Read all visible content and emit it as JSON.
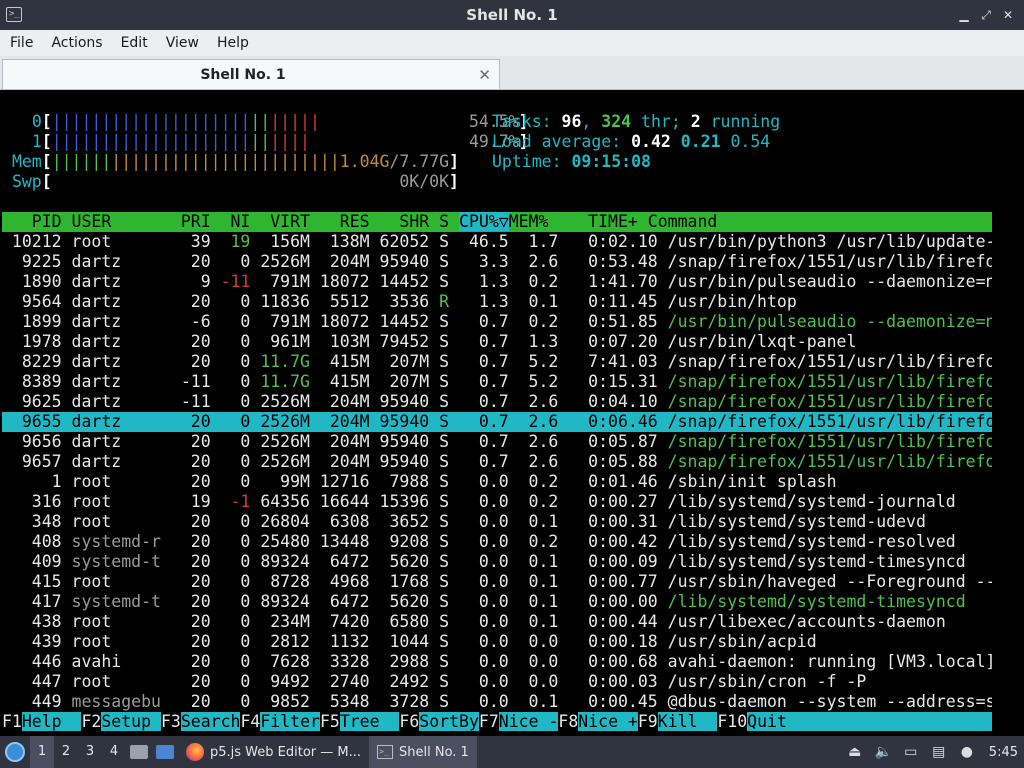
{
  "window": {
    "title": "Shell No. 1",
    "icon": "terminal-icon",
    "controls": [
      "minimize",
      "maximize",
      "close"
    ]
  },
  "menu": [
    "File",
    "Actions",
    "Edit",
    "View",
    "Help"
  ],
  "tab": {
    "label": "Shell No. 1",
    "close_glyph": "✕"
  },
  "htop": {
    "meters": [
      {
        "label": "0",
        "bar_blue": "||||||||||||||||||||",
        "bar_green": "||",
        "bar_red": "|||||",
        "value": "54.5%"
      },
      {
        "label": "1",
        "bar_blue": "||||||||||||||||||||",
        "bar_green": "||",
        "bar_red": "||||",
        "value": "49.7%"
      },
      {
        "label": "Mem",
        "bar_green": "||||||",
        "bar_orange": "|||||||||||||||||||||||",
        "value_prefix": "1.04G",
        "value_suffix": "/7.77G"
      },
      {
        "label": "Swp",
        "value": "0K/0K"
      }
    ],
    "tasks": {
      "label": "Tasks: ",
      "count": "96",
      "sep1": ", ",
      "threads": "324",
      "thr_label": " thr; ",
      "running": "2",
      "running_label": " running"
    },
    "load": {
      "label": "Load average: ",
      "l1": "0.42",
      "l5": "0.21",
      "l15": "0.54"
    },
    "uptime": {
      "label": "Uptime: ",
      "value": "09:15:08"
    },
    "columns": [
      "PID",
      "USER",
      "PRI",
      "NI",
      "VIRT",
      "RES",
      "SHR",
      "S",
      "CPU%▽",
      "MEM%",
      "TIME+",
      "Command"
    ],
    "sort_column": "CPU%▽",
    "selected_pid": "9655",
    "processes": [
      {
        "pid": "10212",
        "user": "root",
        "pri": "39",
        "ni": "19",
        "virt": "156M",
        "res": "138M",
        "shr": "62052",
        "s": "S",
        "cpu": "46.5",
        "mem": "1.7",
        "time": "0:02.10",
        "cmd": "/usr/bin/python3 /usr/lib/update-n"
      },
      {
        "pid": "9225",
        "user": "dartz",
        "pri": "20",
        "ni": "0",
        "virt": "2526M",
        "res": "204M",
        "shr": "95940",
        "s": "S",
        "cpu": "3.3",
        "mem": "2.6",
        "time": "0:53.48",
        "cmd": "/snap/firefox/1551/usr/lib/firefox"
      },
      {
        "pid": "1890",
        "user": "dartz",
        "pri": "9",
        "ni": "-11",
        "virt": "791M",
        "res": "18072",
        "shr": "14452",
        "s": "S",
        "cpu": "1.3",
        "mem": "0.2",
        "time": "1:41.70",
        "cmd": "/usr/bin/pulseaudio --daemonize=no"
      },
      {
        "pid": "9564",
        "user": "dartz",
        "pri": "20",
        "ni": "0",
        "virt": "11836",
        "res": "5512",
        "shr": "3536",
        "s": "R",
        "cpu": "1.3",
        "mem": "0.1",
        "time": "0:11.45",
        "cmd": "/usr/bin/htop"
      },
      {
        "pid": "1899",
        "user": "dartz",
        "pri": "-6",
        "ni": "0",
        "virt": "791M",
        "res": "18072",
        "shr": "14452",
        "s": "S",
        "cpu": "0.7",
        "mem": "0.2",
        "time": "0:51.85",
        "cmd": "/usr/bin/pulseaudio --daemonize=no",
        "thread": true
      },
      {
        "pid": "1978",
        "user": "dartz",
        "pri": "20",
        "ni": "0",
        "virt": "961M",
        "res": "103M",
        "shr": "79452",
        "s": "S",
        "cpu": "0.7",
        "mem": "1.3",
        "time": "0:07.20",
        "cmd": "/usr/bin/lxqt-panel"
      },
      {
        "pid": "8229",
        "user": "dartz",
        "pri": "20",
        "ni": "0",
        "virt": "11.7G",
        "res": "415M",
        "shr": "207M",
        "s": "S",
        "cpu": "0.7",
        "mem": "5.2",
        "time": "7:41.03",
        "cmd": "/snap/firefox/1551/usr/lib/firefox"
      },
      {
        "pid": "8389",
        "user": "dartz",
        "pri": "-11",
        "ni": "0",
        "virt": "11.7G",
        "res": "415M",
        "shr": "207M",
        "s": "S",
        "cpu": "0.7",
        "mem": "5.2",
        "time": "0:15.31",
        "cmd": "/snap/firefox/1551/usr/lib/firefox",
        "thread": true
      },
      {
        "pid": "9625",
        "user": "dartz",
        "pri": "-11",
        "ni": "0",
        "virt": "2526M",
        "res": "204M",
        "shr": "95940",
        "s": "S",
        "cpu": "0.7",
        "mem": "2.6",
        "time": "0:04.10",
        "cmd": "/snap/firefox/1551/usr/lib/firefox",
        "thread": true
      },
      {
        "pid": "9655",
        "user": "dartz",
        "pri": "20",
        "ni": "0",
        "virt": "2526M",
        "res": "204M",
        "shr": "95940",
        "s": "S",
        "cpu": "0.7",
        "mem": "2.6",
        "time": "0:06.46",
        "cmd": "/snap/firefox/1551/usr/lib/firefox"
      },
      {
        "pid": "9656",
        "user": "dartz",
        "pri": "20",
        "ni": "0",
        "virt": "2526M",
        "res": "204M",
        "shr": "95940",
        "s": "S",
        "cpu": "0.7",
        "mem": "2.6",
        "time": "0:05.87",
        "cmd": "/snap/firefox/1551/usr/lib/firefox",
        "thread": true
      },
      {
        "pid": "9657",
        "user": "dartz",
        "pri": "20",
        "ni": "0",
        "virt": "2526M",
        "res": "204M",
        "shr": "95940",
        "s": "S",
        "cpu": "0.7",
        "mem": "2.6",
        "time": "0:05.88",
        "cmd": "/snap/firefox/1551/usr/lib/firefox",
        "thread": true
      },
      {
        "pid": "1",
        "user": "root",
        "pri": "20",
        "ni": "0",
        "virt": "99M",
        "res": "12716",
        "shr": "7988",
        "s": "S",
        "cpu": "0.0",
        "mem": "0.2",
        "time": "0:01.46",
        "cmd": "/sbin/init splash"
      },
      {
        "pid": "316",
        "user": "root",
        "pri": "19",
        "ni": "-1",
        "virt": "64356",
        "res": "16644",
        "shr": "15396",
        "s": "S",
        "cpu": "0.0",
        "mem": "0.2",
        "time": "0:00.27",
        "cmd": "/lib/systemd/systemd-journald"
      },
      {
        "pid": "348",
        "user": "root",
        "pri": "20",
        "ni": "0",
        "virt": "26804",
        "res": "6308",
        "shr": "3652",
        "s": "S",
        "cpu": "0.0",
        "mem": "0.1",
        "time": "0:00.31",
        "cmd": "/lib/systemd/systemd-udevd"
      },
      {
        "pid": "408",
        "user": "systemd-r",
        "pri": "20",
        "ni": "0",
        "virt": "25480",
        "res": "13448",
        "shr": "9208",
        "s": "S",
        "cpu": "0.0",
        "mem": "0.2",
        "time": "0:00.42",
        "cmd": "/lib/systemd/systemd-resolved"
      },
      {
        "pid": "409",
        "user": "systemd-t",
        "pri": "20",
        "ni": "0",
        "virt": "89324",
        "res": "6472",
        "shr": "5620",
        "s": "S",
        "cpu": "0.0",
        "mem": "0.1",
        "time": "0:00.09",
        "cmd": "/lib/systemd/systemd-timesyncd"
      },
      {
        "pid": "415",
        "user": "root",
        "pri": "20",
        "ni": "0",
        "virt": "8728",
        "res": "4968",
        "shr": "1768",
        "s": "S",
        "cpu": "0.0",
        "mem": "0.1",
        "time": "0:00.77",
        "cmd": "/usr/sbin/haveged --Foreground --v"
      },
      {
        "pid": "417",
        "user": "systemd-t",
        "pri": "20",
        "ni": "0",
        "virt": "89324",
        "res": "6472",
        "shr": "5620",
        "s": "S",
        "cpu": "0.0",
        "mem": "0.1",
        "time": "0:00.00",
        "cmd": "/lib/systemd/systemd-timesyncd",
        "thread": true
      },
      {
        "pid": "438",
        "user": "root",
        "pri": "20",
        "ni": "0",
        "virt": "234M",
        "res": "7420",
        "shr": "6580",
        "s": "S",
        "cpu": "0.0",
        "mem": "0.1",
        "time": "0:00.44",
        "cmd": "/usr/libexec/accounts-daemon"
      },
      {
        "pid": "439",
        "user": "root",
        "pri": "20",
        "ni": "0",
        "virt": "2812",
        "res": "1132",
        "shr": "1044",
        "s": "S",
        "cpu": "0.0",
        "mem": "0.0",
        "time": "0:00.18",
        "cmd": "/usr/sbin/acpid"
      },
      {
        "pid": "446",
        "user": "avahi",
        "pri": "20",
        "ni": "0",
        "virt": "7628",
        "res": "3328",
        "shr": "2988",
        "s": "S",
        "cpu": "0.0",
        "mem": "0.0",
        "time": "0:00.68",
        "cmd": "avahi-daemon: running [VM3.local]"
      },
      {
        "pid": "447",
        "user": "root",
        "pri": "20",
        "ni": "0",
        "virt": "9492",
        "res": "2740",
        "shr": "2492",
        "s": "S",
        "cpu": "0.0",
        "mem": "0.0",
        "time": "0:00.03",
        "cmd": "/usr/sbin/cron -f -P"
      },
      {
        "pid": "449",
        "user": "messagebu",
        "pri": "20",
        "ni": "0",
        "virt": "9852",
        "res": "5348",
        "shr": "3728",
        "s": "S",
        "cpu": "0.0",
        "mem": "0.1",
        "time": "0:00.45",
        "cmd": "@dbus-daemon --system --address=sy"
      }
    ],
    "function_keys": [
      {
        "key": "F1",
        "label": "Help  "
      },
      {
        "key": "F2",
        "label": "Setup "
      },
      {
        "key": "F3",
        "label": "Search"
      },
      {
        "key": "F4",
        "label": "Filter"
      },
      {
        "key": "F5",
        "label": "Tree  "
      },
      {
        "key": "F6",
        "label": "SortBy"
      },
      {
        "key": "F7",
        "label": "Nice -"
      },
      {
        "key": "F8",
        "label": "Nice +"
      },
      {
        "key": "F9",
        "label": "Kill  "
      },
      {
        "key": "F10",
        "label": "Quit                                 "
      }
    ]
  },
  "taskbar": {
    "workspaces": [
      "1",
      "2",
      "3",
      "4"
    ],
    "active_workspace": "1",
    "tasks": [
      {
        "label": "p5.js Web Editor — M...",
        "icon": "firefox-icon"
      },
      {
        "label": "Shell No. 1",
        "icon": "terminal-icon",
        "active": true
      }
    ],
    "tray_icons": [
      "eject-icon",
      "volume-icon",
      "network-icon",
      "clipboard-icon",
      "notification-icon"
    ],
    "clock": "5:45"
  },
  "colors": {
    "terminal_bg": "#000000",
    "cyan": "#21b8c5",
    "header_green": "#2fb52f",
    "titlebar": "#2f343f"
  }
}
